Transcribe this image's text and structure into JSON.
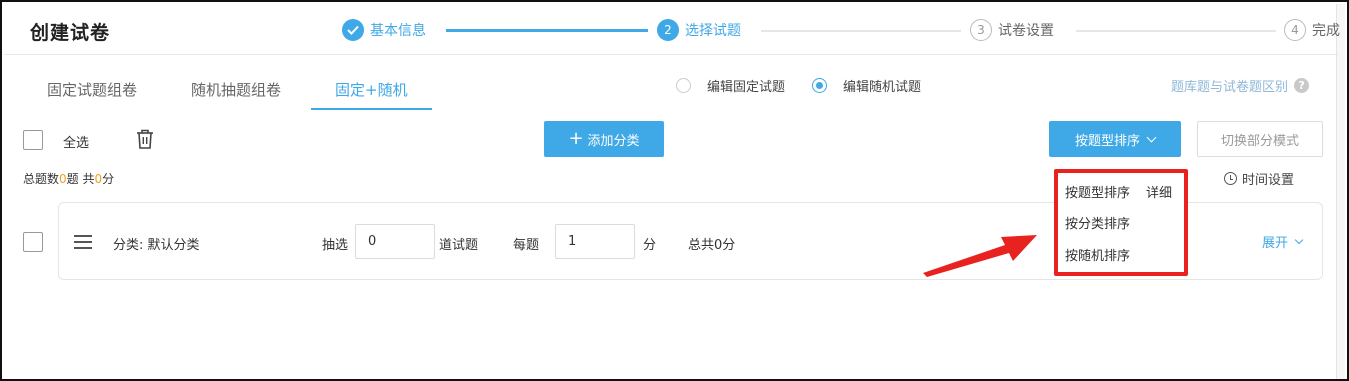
{
  "header": {
    "title": "创建试卷",
    "steps": [
      {
        "label": "基本信息",
        "state": "done"
      },
      {
        "label": "选择试题",
        "number": "2",
        "state": "active"
      },
      {
        "label": "试卷设置",
        "number": "3",
        "state": "pending"
      },
      {
        "label": "完成",
        "number": "4",
        "state": "pending"
      }
    ]
  },
  "tabs": [
    {
      "label": "固定试题组卷"
    },
    {
      "label": "随机抽题组卷"
    },
    {
      "label": "固定+随机",
      "active": true
    }
  ],
  "edit_mode": {
    "options": [
      {
        "label": "编辑固定试题",
        "checked": false
      },
      {
        "label": "编辑随机试题",
        "checked": true
      }
    ]
  },
  "diff_link": "题库题与试卷题区别",
  "toolbar": {
    "select_all_label": "全选",
    "add_category_label": "添加分类",
    "sort_button_label": "按题型排序",
    "switch_mode_label": "切换部分模式"
  },
  "summary": {
    "prefix": "总题数",
    "count": "0",
    "mid": "题 共",
    "score": "0",
    "suffix": "分"
  },
  "time_setting": "时间设置",
  "category": {
    "label": "分类: 默认分类",
    "draw_label": "抽选",
    "draw_count": "0",
    "unit_label": "道试题",
    "each_label": "每题",
    "each_score": "1",
    "score_unit": "分",
    "total_label": "总共0分",
    "expand_label": "展开"
  },
  "sort_menu": {
    "items": [
      "按题型排序",
      "按分类排序",
      "按随机排序"
    ],
    "detail_label": "详细"
  },
  "colors": {
    "accent": "#3fa8e6",
    "highlight": "#e8231f",
    "number_orange": "#f0a020"
  }
}
